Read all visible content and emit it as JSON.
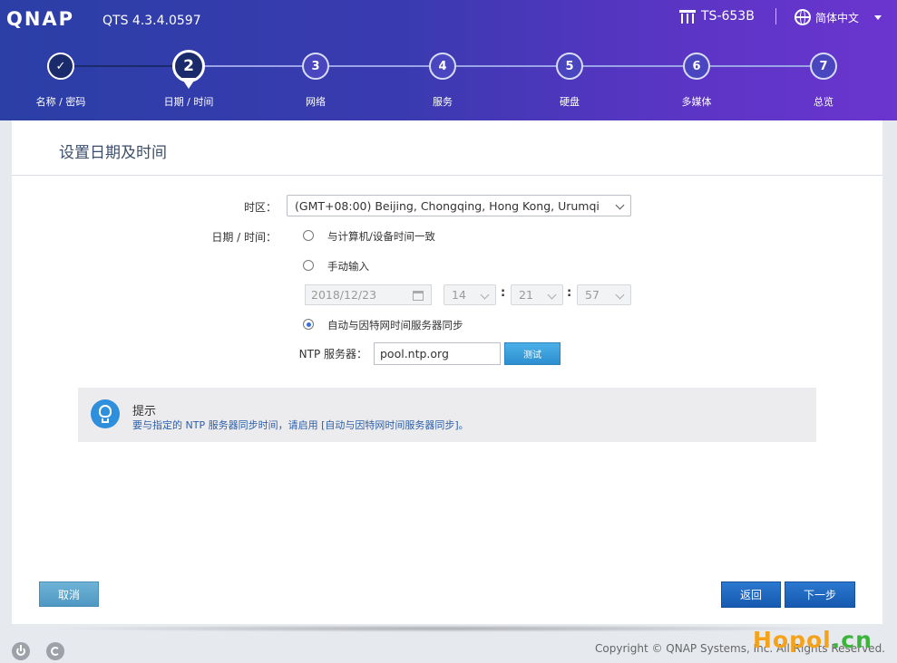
{
  "header": {
    "logo": "QNAP",
    "version": "QTS 4.3.4.0597",
    "model": "TS-653B",
    "language": "简体中文"
  },
  "steps": [
    {
      "label": "名称 / 密码",
      "num": "✓"
    },
    {
      "label": "日期 / 时间",
      "num": "2"
    },
    {
      "label": "网络",
      "num": "3"
    },
    {
      "label": "服务",
      "num": "4"
    },
    {
      "label": "硬盘",
      "num": "5"
    },
    {
      "label": "多媒体",
      "num": "6"
    },
    {
      "label": "总览",
      "num": "7"
    }
  ],
  "panel": {
    "title": "设置日期及时间",
    "timezone_label": "时区：",
    "timezone_value": "(GMT+08:00) Beijing, Chongqing, Hong Kong, Urumqi",
    "datetime_label": "日期 / 时间：",
    "options": {
      "sync_pc": "与计算机/设备时间一致",
      "manual": "手动输入",
      "ntp": "自动与因特网时间服务器同步"
    },
    "manual_date": "2018/12/23",
    "hour": "14",
    "minute": "21",
    "second": "57",
    "colon": ":",
    "ntp_label": "NTP 服务器：",
    "ntp_value": "pool.ntp.org",
    "test_button": "测试"
  },
  "tip": {
    "title": "提示",
    "text": "要与指定的 NTP 服务器同步时间，请启用 [自动与因特网时间服务器同步]。"
  },
  "buttons": {
    "cancel": "取消",
    "back": "返回",
    "next": "下一步"
  },
  "footer": {
    "copyright": "Copyright © QNAP Systems, Inc. All Rights Reserved.",
    "watermark_a": "Hopol",
    "watermark_b": ".cn"
  }
}
